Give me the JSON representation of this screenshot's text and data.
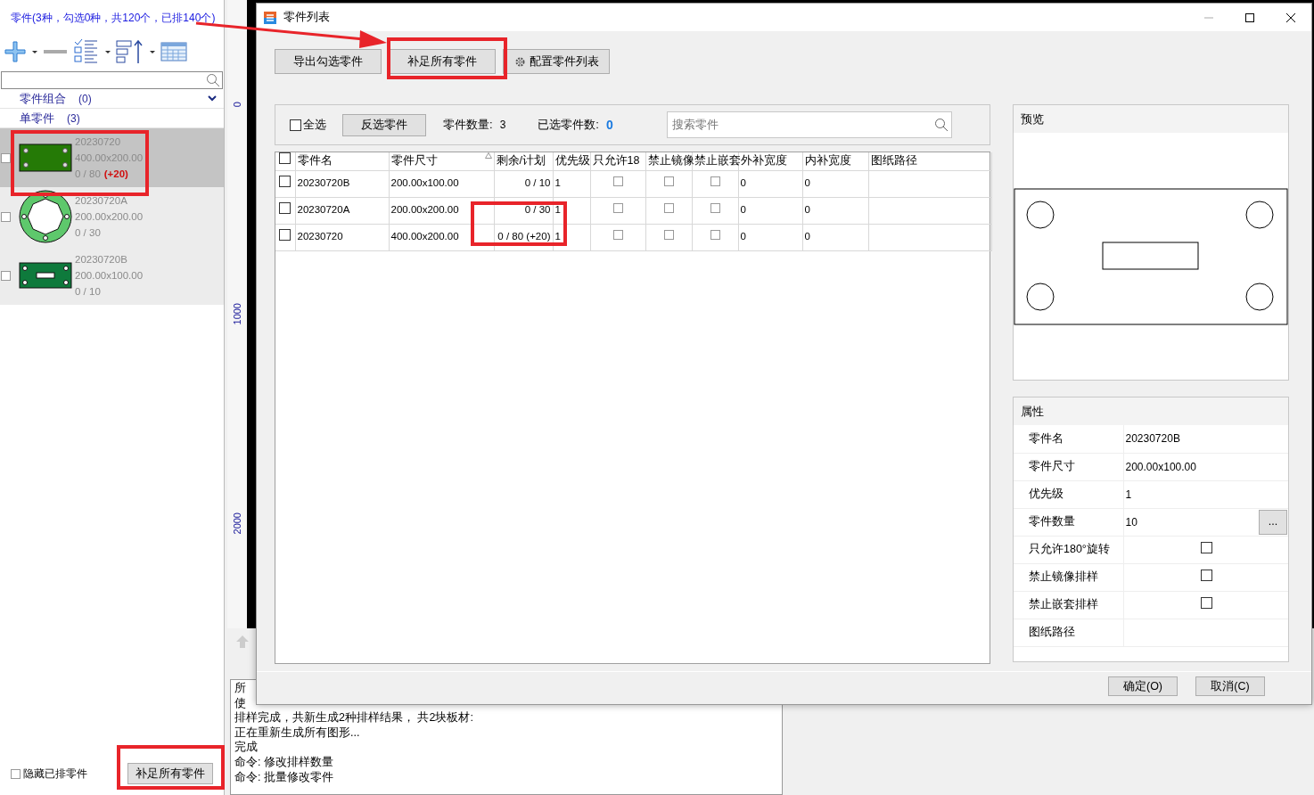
{
  "app": {
    "summary": "零件(3种，勾选0种，共120个，已排140个)",
    "groups": [
      {
        "label": "零件组合",
        "count": "(0)",
        "expanded": true
      },
      {
        "label": "单零件",
        "count": "(3)"
      }
    ],
    "parts": [
      {
        "name": "20230720",
        "size": "400.00x200.00",
        "count": "0 / 80",
        "extra": "(+20)",
        "selected": true,
        "checked": false,
        "kind": "plate"
      },
      {
        "name": "20230720A",
        "size": "200.00x200.00",
        "count": "0 / 30",
        "selected": false,
        "checked": false,
        "kind": "ring"
      },
      {
        "name": "20230720B",
        "size": "200.00x100.00",
        "count": "0 / 10",
        "selected": false,
        "checked": false,
        "kind": "slot"
      }
    ],
    "hide_placed": {
      "label": "隐藏已排零件",
      "checked": false
    },
    "fill_button": "补足所有零件",
    "ruler_labels": [
      "0",
      "1000",
      "2000"
    ],
    "log": [
      "所",
      "使",
      "排样完成，共新生成2种排样结果，  共2块板材:",
      "正在重新生成所有图形...",
      "完成",
      "命令: 修改排样数量",
      "命令: 批量修改零件"
    ]
  },
  "dialog": {
    "title": "零件列表",
    "toolbar_buttons": [
      {
        "label": "导出勾选零件",
        "kind": "plain"
      },
      {
        "label": "补足所有零件",
        "kind": "plain"
      },
      {
        "label": "配置零件列表",
        "kind": "gear"
      }
    ],
    "select_all": {
      "label": "全选",
      "checked": false
    },
    "invert_button": "反选零件",
    "part_count": {
      "label": "零件数量:",
      "value": "3"
    },
    "selected_count": {
      "label": "已选零件数:",
      "value": "0"
    },
    "search": {
      "placeholder": "搜索零件"
    },
    "table": {
      "columns": [
        {
          "label": "零件名"
        },
        {
          "label": "零件尺寸",
          "sorted": true
        },
        {
          "label": "剩余/计划"
        },
        {
          "label": "优先级"
        },
        {
          "label": "只允许18"
        },
        {
          "label": "禁止镜像"
        },
        {
          "label": "禁止嵌套"
        },
        {
          "label": "外补宽度"
        },
        {
          "label": "内补宽度"
        },
        {
          "label": "图纸路径"
        }
      ],
      "rows": [
        {
          "checked": false,
          "name": "20230720B",
          "size": "200.00x100.00",
          "count": "0 / 10",
          "priority": "1",
          "rotate180": false,
          "no_mirror": false,
          "no_nest": false,
          "outer": "0",
          "inner": "0"
        },
        {
          "checked": false,
          "name": "20230720A",
          "size": "200.00x200.00",
          "count": "0 / 30",
          "priority": "1",
          "rotate180": false,
          "no_mirror": false,
          "no_nest": false,
          "outer": "0",
          "inner": "0"
        },
        {
          "checked": false,
          "name": "20230720",
          "size": "400.00x200.00",
          "count": "0 / 80 (+20)",
          "priority": "1",
          "rotate180": false,
          "no_mirror": false,
          "no_nest": false,
          "outer": "0",
          "inner": "0"
        }
      ]
    },
    "preview": {
      "title": "预览"
    },
    "properties": {
      "title": "属性",
      "rows": [
        {
          "kind": "text",
          "label": "零件名",
          "value": "20230720B"
        },
        {
          "kind": "text",
          "label": "零件尺寸",
          "value": "200.00x100.00"
        },
        {
          "kind": "text",
          "label": "优先级",
          "value": "1"
        },
        {
          "kind": "button",
          "label": "零件数量",
          "value": "10",
          "button": "..."
        },
        {
          "kind": "check",
          "label": "只允许180°旋转",
          "checked": false
        },
        {
          "kind": "check",
          "label": "禁止镜像排样",
          "checked": false
        },
        {
          "kind": "check",
          "label": "禁止嵌套排样",
          "checked": false
        },
        {
          "kind": "text",
          "label": "图纸路径"
        }
      ]
    },
    "footer_buttons": [
      "确定(O)",
      "取消(C)"
    ]
  }
}
